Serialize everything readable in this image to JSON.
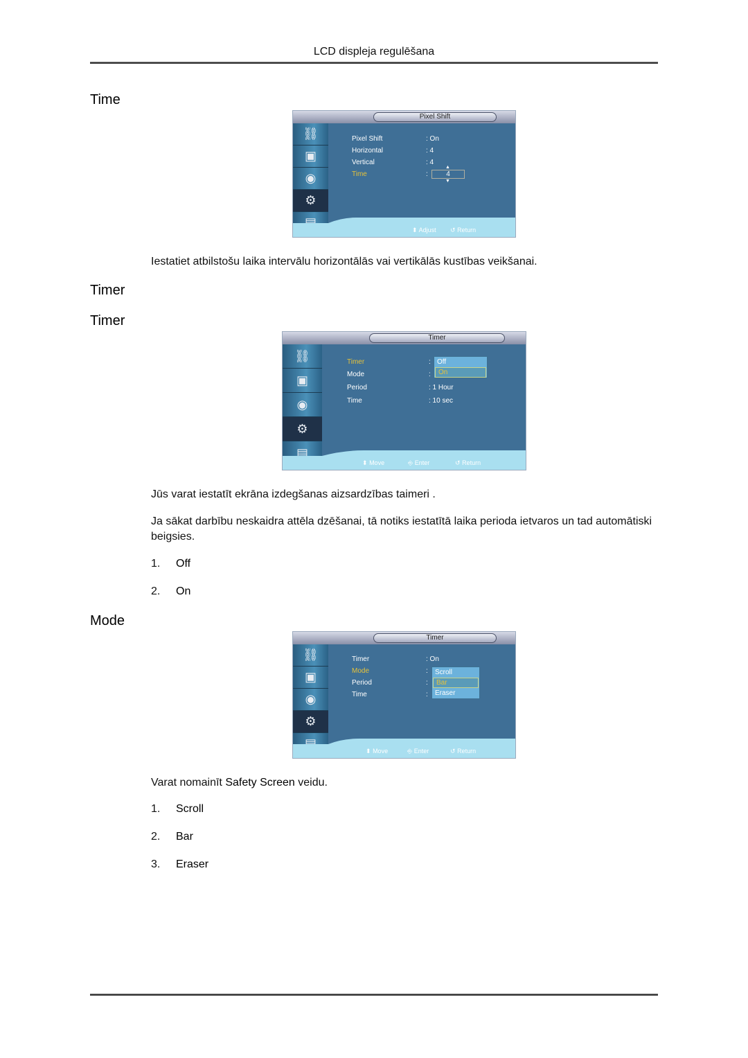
{
  "page": {
    "header": "LCD displeja regulēšana"
  },
  "sections": {
    "time": {
      "heading": "Time",
      "description": "Iestatiet atbilstošu laika intervālu horizontālās vai vertikālās kustības veikšanai."
    },
    "timer_parent": {
      "heading": "Timer"
    },
    "timer": {
      "heading": "Timer",
      "description1": "Jūs varat iestatīt ekrāna izdegšanas aizsardzības taimeri .",
      "description2": "Ja sākat darbību neskaidra attēla dzēšanai, tā notiks iestatītā laika perioda ietvaros un tad automātiski beigsies.",
      "options": [
        {
          "num": "1.",
          "label": "Off"
        },
        {
          "num": "2.",
          "label": "On"
        }
      ]
    },
    "mode": {
      "heading": "Mode",
      "desc_prefix": "Varat nomainīt ",
      "desc_bold": "Safety Screen",
      "desc_suffix": " veidu.",
      "options": [
        {
          "num": "1.",
          "label": "Scroll"
        },
        {
          "num": "2.",
          "label": "Bar"
        },
        {
          "num": "3.",
          "label": "Eraser"
        }
      ]
    }
  },
  "osd_sidebar_icons": [
    "input-icon",
    "picture-icon",
    "sound-icon",
    "setup-icon",
    "multi-control-icon"
  ],
  "osd1": {
    "title": "Pixel Shift",
    "rows": [
      {
        "label": "Pixel Shift",
        "value": ": On"
      },
      {
        "label": "Horizontal",
        "value": ": 4"
      },
      {
        "label": "Vertical",
        "value": ": 4"
      },
      {
        "label": "Time",
        "value": ":",
        "spinner_value": "4"
      }
    ],
    "footer": {
      "adjust": "Adjust",
      "return": "Return"
    }
  },
  "osd2": {
    "title": "Timer",
    "rows": [
      {
        "label": "Timer",
        "value": ":"
      },
      {
        "label": "Mode",
        "value": ":"
      },
      {
        "label": "Period",
        "value": ": 1 Hour"
      },
      {
        "label": "Time",
        "value": ": 10 sec"
      }
    ],
    "dropdown": [
      "Off",
      "On"
    ],
    "dropdown_selected": "On",
    "footer": {
      "move": "Move",
      "enter": "Enter",
      "return": "Return"
    }
  },
  "osd3": {
    "title": "Timer",
    "rows": [
      {
        "label": "Timer",
        "value": ": On"
      },
      {
        "label": "Mode",
        "value": ":"
      },
      {
        "label": "Period",
        "value": ":"
      },
      {
        "label": "Time",
        "value": ":"
      }
    ],
    "dropdown": [
      "Scroll",
      "Bar",
      "Eraser"
    ],
    "dropdown_selected": "Bar",
    "footer": {
      "move": "Move",
      "enter": "Enter",
      "return": "Return"
    }
  },
  "colors": {
    "osd_bg": "#3f6f96",
    "osd_highlight": "#e6c23a",
    "osd_footer": "#a9dff0",
    "dropdown_bg": "#6cb2dc"
  }
}
